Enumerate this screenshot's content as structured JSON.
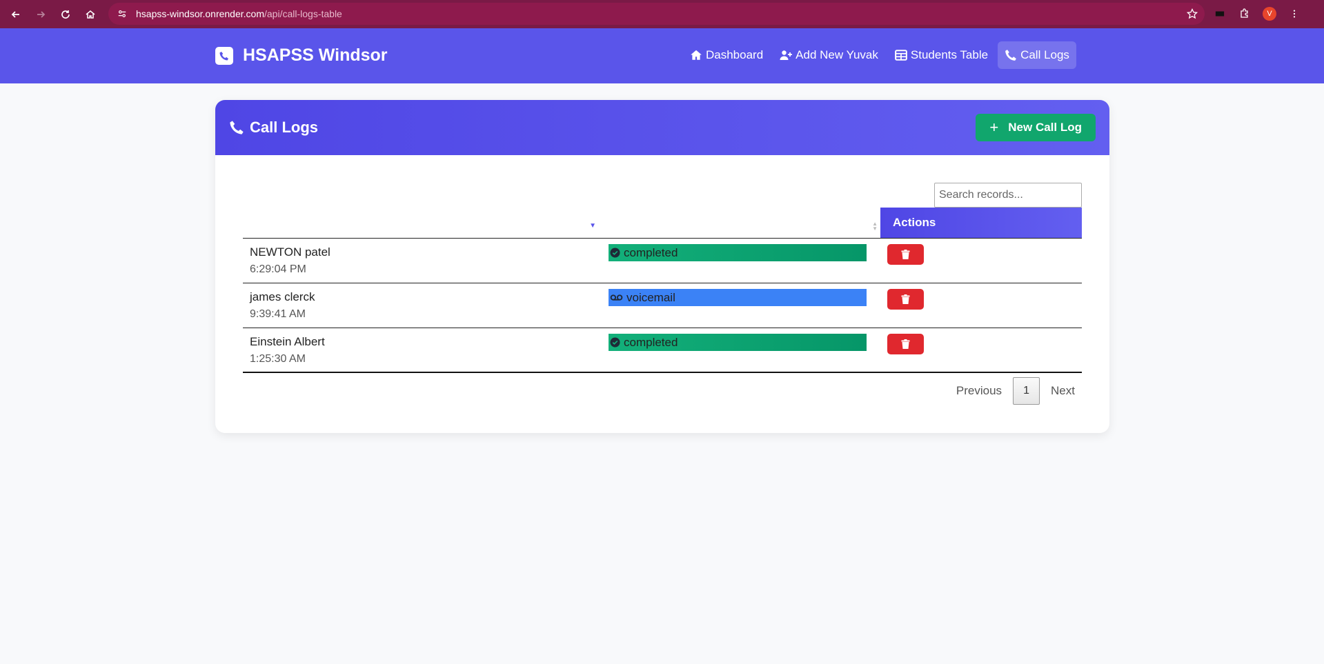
{
  "browser": {
    "url_host": "hsapss-windsor.onrender.com",
    "url_path": "/api/call-logs-table",
    "profile_initial": "V"
  },
  "navbar": {
    "brand": "HSAPSS Windsor",
    "links": [
      {
        "label": "Dashboard",
        "icon": "home-icon"
      },
      {
        "label": "Add New Yuvak",
        "icon": "user-plus-icon"
      },
      {
        "label": "Students Table",
        "icon": "table-icon"
      },
      {
        "label": "Call Logs",
        "icon": "phone-icon",
        "active": true
      }
    ]
  },
  "card": {
    "title": "Call Logs",
    "new_button": "New Call Log",
    "search_placeholder": "Search records...",
    "columns": [
      "",
      "",
      "Actions"
    ],
    "rows": [
      {
        "name": "NEWTON patel",
        "time": "6:29:04 PM",
        "status": "completed"
      },
      {
        "name": "james clerck",
        "time": "9:39:41 AM",
        "status": "voicemail"
      },
      {
        "name": "Einstein Albert",
        "time": "1:25:30 AM",
        "status": "completed"
      }
    ],
    "pagination": {
      "previous": "Previous",
      "page": "1",
      "next": "Next"
    }
  },
  "colors": {
    "accent": "#5a55ea",
    "success": "#11a66d",
    "info": "#3b82f6",
    "danger": "#e0282e",
    "browser": "#7a1a46"
  }
}
